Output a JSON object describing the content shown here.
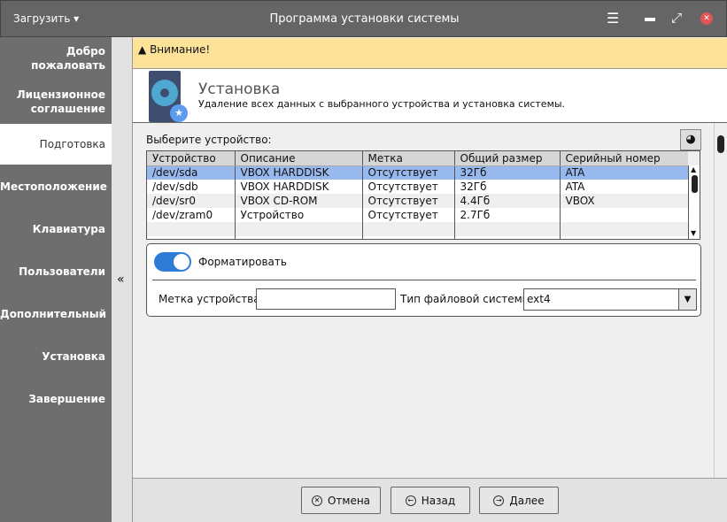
{
  "titlebar": {
    "menu_label": "Загрузить",
    "title": "Программа установки системы"
  },
  "sidebar": {
    "items": [
      {
        "label": "Добро пожаловать"
      },
      {
        "label": "Лицензионное соглашение"
      },
      {
        "label": "Подготовка",
        "active": true
      },
      {
        "label": "Местоположение"
      },
      {
        "label": "Клавиатура"
      },
      {
        "label": "Пользователи"
      },
      {
        "label": "Дополнительный"
      },
      {
        "label": "Установка"
      },
      {
        "label": "Завершение"
      }
    ]
  },
  "collapse_label": "«",
  "warning": {
    "text": "Внимание!",
    "color": "#fde39a"
  },
  "header": {
    "title": "Установка",
    "subtitle": "Удаление всех данных с выбранного устройства и установка системы."
  },
  "device": {
    "label": "Выберите устройство:",
    "columns": [
      "Устройство",
      "Описание",
      "Метка",
      "Общий размер",
      "Серийный номер"
    ],
    "rows": [
      [
        "/dev/sda",
        "VBOX HARDDISK",
        "Отсутствует",
        "32Гб",
        "ATA"
      ],
      [
        "/dev/sdb",
        "VBOX HARDDISK",
        "Отсутствует",
        "32Гб",
        "ATA"
      ],
      [
        "/dev/sr0",
        "VBOX CD-ROM",
        "Отсутствует",
        "4.4Гб",
        "VBOX"
      ],
      [
        "/dev/zram0",
        "Устройство",
        "Отсутствует",
        "2.7Гб",
        ""
      ]
    ],
    "selected_row": 0
  },
  "format": {
    "toggle_label": "Форматировать",
    "enabled": true,
    "device_label_label": "Метка устройства:",
    "device_label_value": "",
    "fs_label": "Тип файловой системы:",
    "fs_value": "ext4"
  },
  "footer": {
    "cancel": "Отмена",
    "back": "Назад",
    "next": "Далее"
  },
  "colors": {
    "accent": "#2f7cd8",
    "selection": "#97b9ee"
  }
}
